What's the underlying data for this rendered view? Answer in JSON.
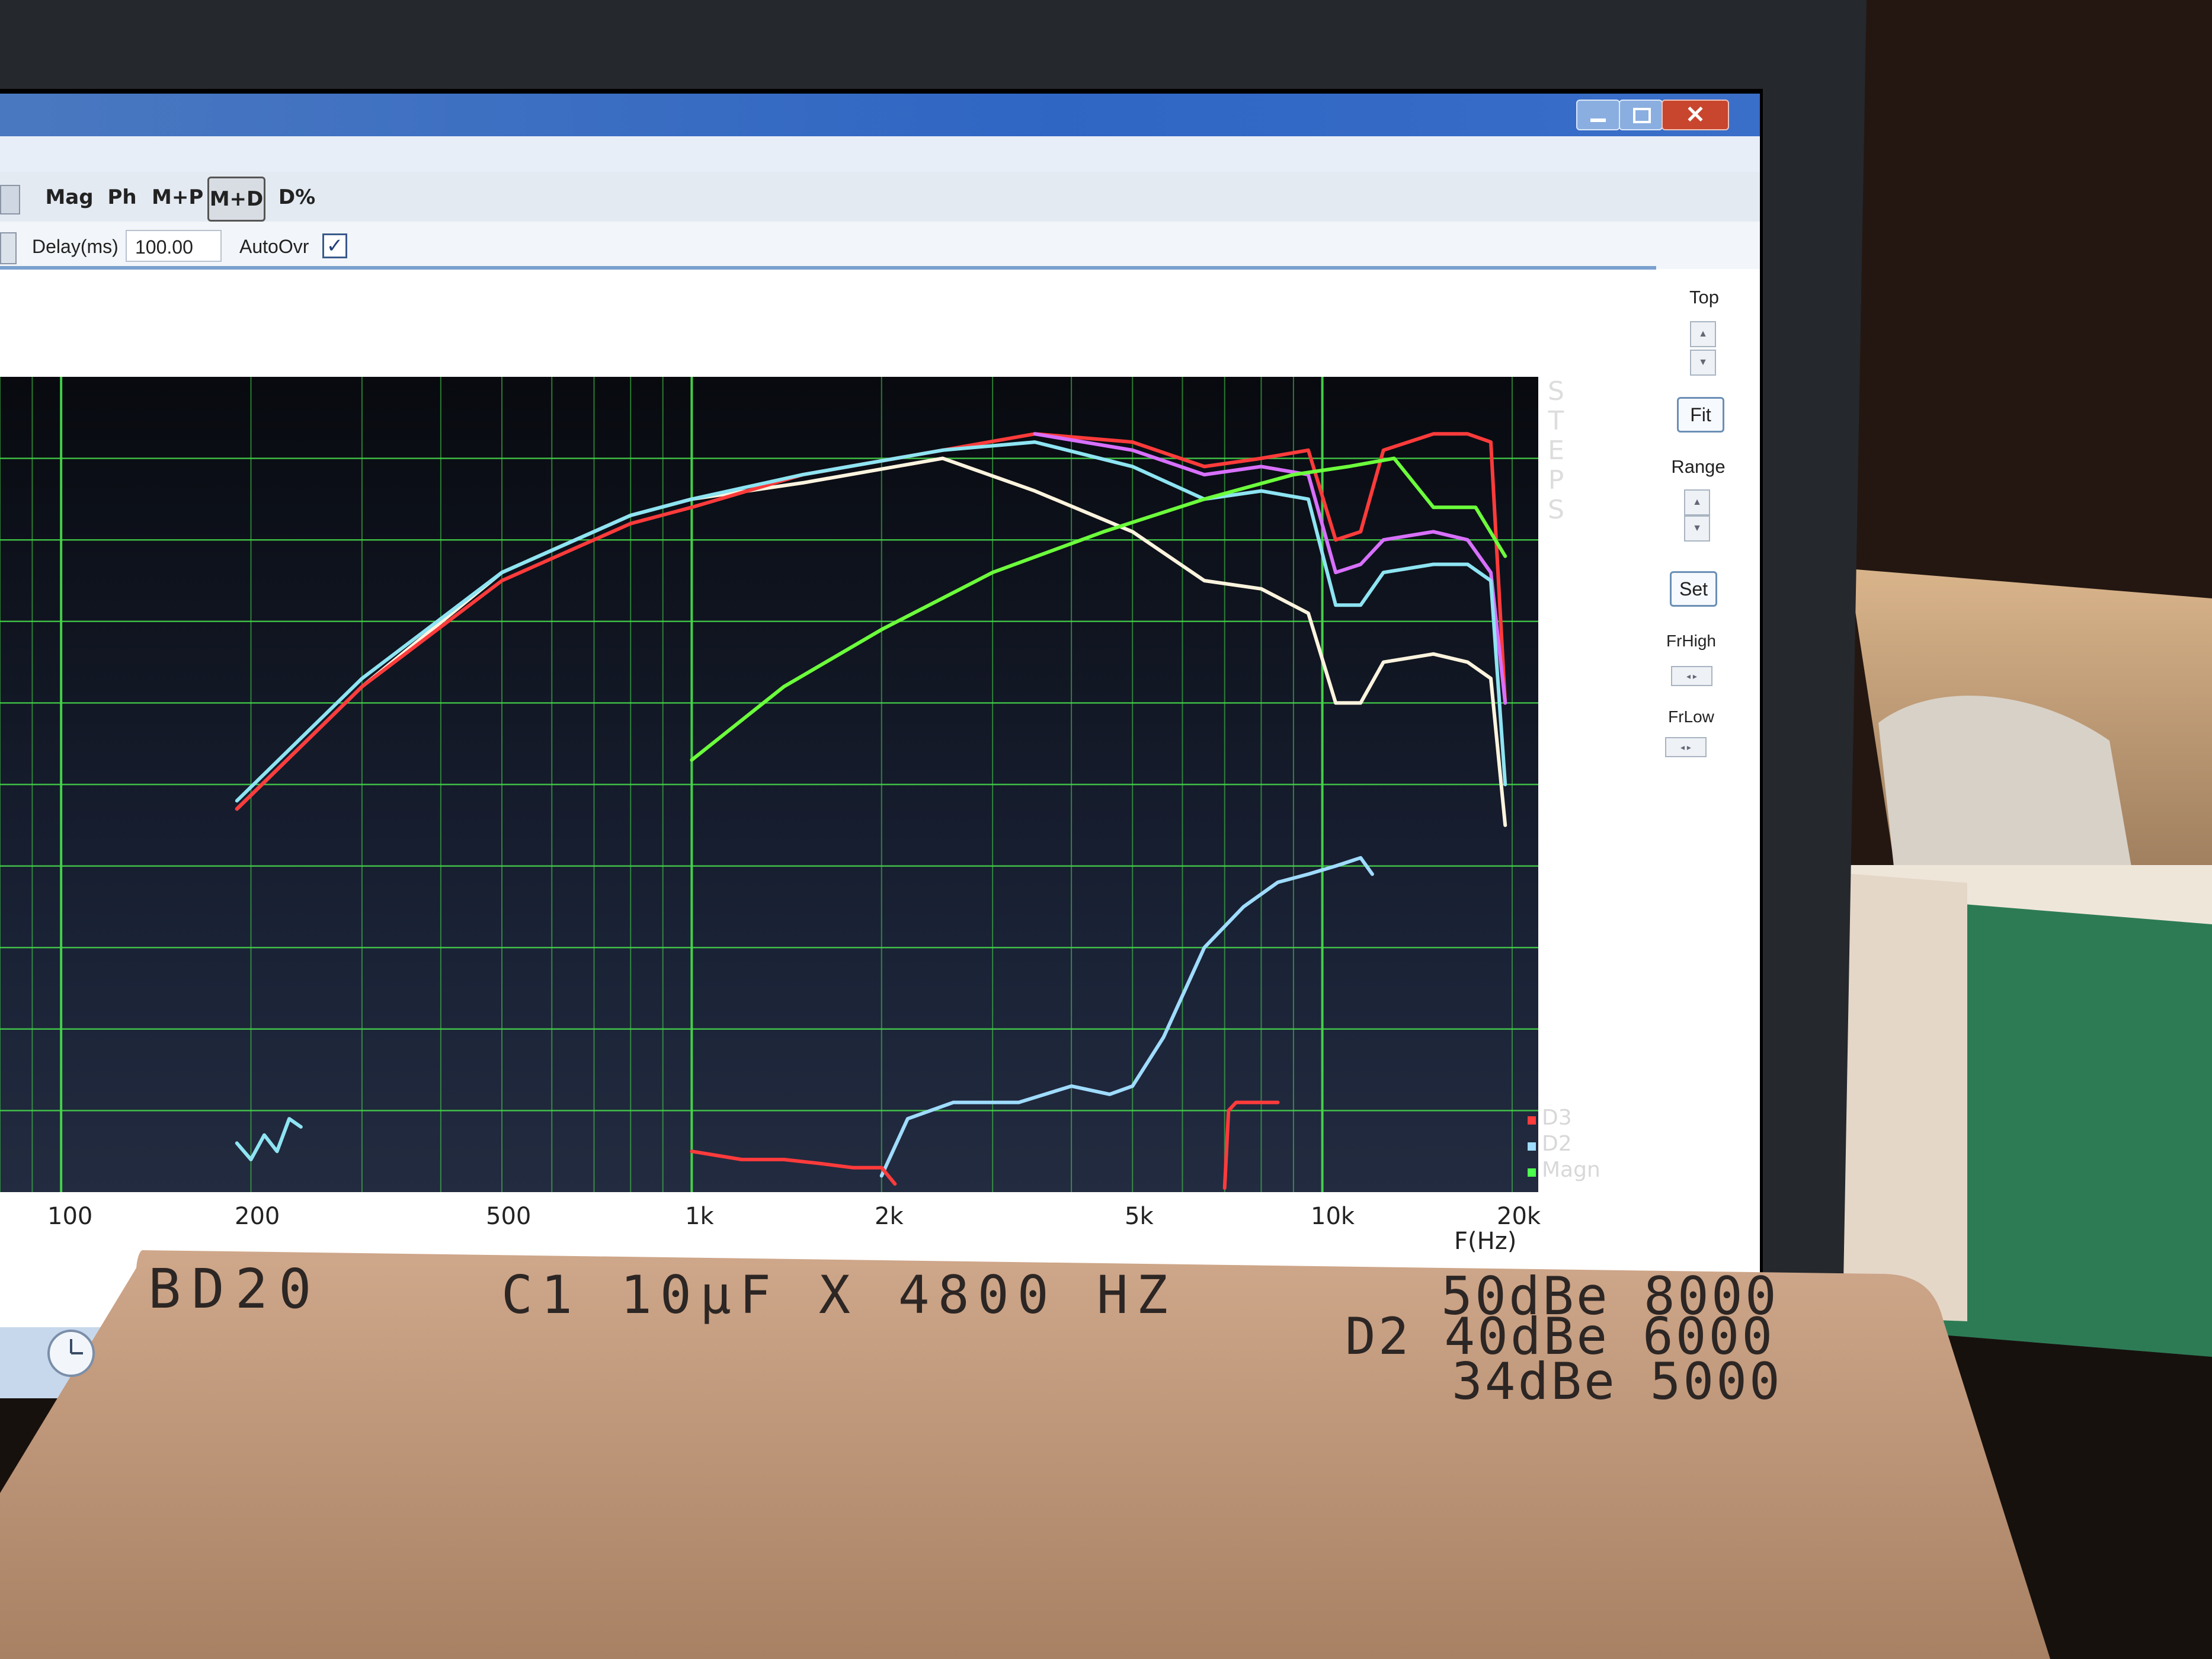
{
  "toolbar": {
    "buttons": [
      {
        "label": "Mag"
      },
      {
        "label": "Ph"
      },
      {
        "label": "M+P"
      },
      {
        "label": "M+D",
        "active": true
      },
      {
        "label": "D%"
      }
    ],
    "delay_label": "Delay(ms)",
    "delay_value": "100.00",
    "autoovr_label": "AutoOvr",
    "autoovr_checked": true
  },
  "side_panel": {
    "top_label": "Top",
    "fit_label": "Fit",
    "range_label": "Range",
    "set_label": "Set",
    "frhigh_label": "FrHigh",
    "frlow_label": "FrLow"
  },
  "window_controls": {
    "minimize": "minimize-icon",
    "restore": "restore-icon",
    "close": "close-icon"
  },
  "plot": {
    "steps_label": [
      "S",
      "T",
      "E",
      "P",
      "S"
    ],
    "x_axis_label": "F(Hz)",
    "x_ticks": [
      {
        "label": "100",
        "hz": 100
      },
      {
        "label": "200",
        "hz": 200
      },
      {
        "label": "500",
        "hz": 500
      },
      {
        "label": "1k",
        "hz": 1000
      },
      {
        "label": "2k",
        "hz": 2000
      },
      {
        "label": "5k",
        "hz": 5000
      },
      {
        "label": "10k",
        "hz": 10000
      },
      {
        "label": "20k",
        "hz": 20000
      }
    ],
    "legend": [
      {
        "label": "D3",
        "color": "#ff3b3b"
      },
      {
        "label": "D2",
        "color": "#9fdcff"
      },
      {
        "label": "Magn",
        "color": "#4cff4c"
      }
    ],
    "colors": {
      "background": "#0c1018",
      "grid": "#46d94a",
      "white_curve": "#fff4de",
      "red_curve": "#ff3b3b",
      "pink_curve": "#d870ff",
      "cyan_curve": "#8ee4f2",
      "green_curve": "#6cff3c",
      "d2_curve": "#9fdcff"
    }
  },
  "chart_data": {
    "type": "line",
    "x_scale": "log",
    "xlabel": "F(Hz)",
    "xlim": [
      80,
      22000
    ],
    "ylim": [
      0,
      10
    ],
    "grid": true,
    "legend_position": "bottom-right",
    "series": [
      {
        "color": "#fff4de",
        "x": [
          190,
          300,
          500,
          800,
          1000,
          1500,
          2500,
          3500,
          5000,
          6500,
          8000,
          9500,
          10500,
          11500,
          12500,
          15000,
          17000,
          18500,
          19500
        ],
        "y": [
          4.7,
          6.2,
          7.6,
          8.3,
          8.5,
          8.7,
          9.0,
          8.6,
          8.1,
          7.5,
          7.4,
          7.1,
          6.0,
          6.0,
          6.5,
          6.6,
          6.5,
          6.3,
          4.5
        ]
      },
      {
        "color": "#ff3b3b",
        "x": [
          190,
          300,
          500,
          800,
          1000,
          1500,
          2500,
          3500,
          5000,
          6500,
          8000,
          9500,
          10500,
          11500,
          12500,
          15000,
          17000,
          18500,
          19500
        ],
        "y": [
          4.7,
          6.2,
          7.5,
          8.2,
          8.4,
          8.8,
          9.1,
          9.3,
          9.2,
          8.9,
          9.0,
          9.1,
          8.0,
          8.1,
          9.1,
          9.3,
          9.3,
          9.2,
          6.0
        ]
      },
      {
        "color": "#d870ff",
        "x": [
          3500,
          5000,
          6500,
          8000,
          9500,
          10500,
          11500,
          12500,
          15000,
          17000,
          18500,
          19500
        ],
        "y": [
          9.3,
          9.1,
          8.8,
          8.9,
          8.8,
          7.6,
          7.7,
          8.0,
          8.1,
          8.0,
          7.6,
          6.0
        ]
      },
      {
        "color": "#8ee4f2",
        "x": [
          190,
          300,
          500,
          800,
          1000,
          1500,
          2500,
          3500,
          5000,
          6500,
          8000,
          9500,
          10500,
          11500,
          12500,
          15000,
          17000,
          18500,
          19500
        ],
        "y": [
          4.8,
          6.3,
          7.6,
          8.3,
          8.5,
          8.8,
          9.1,
          9.2,
          8.9,
          8.5,
          8.6,
          8.5,
          7.2,
          7.2,
          7.6,
          7.7,
          7.7,
          7.5,
          5.0
        ]
      },
      {
        "name": "Magn",
        "color": "#6cff3c",
        "x": [
          1000,
          1400,
          2000,
          3000,
          4500,
          6500,
          9000,
          11000,
          13000,
          15000,
          17500,
          19500
        ],
        "y": [
          5.3,
          6.2,
          6.9,
          7.6,
          8.1,
          8.5,
          8.8,
          8.9,
          9.0,
          8.4,
          8.4,
          7.8
        ]
      },
      {
        "name": "D2",
        "color": "#9fdcff",
        "x": [
          2000,
          2200,
          2600,
          3300,
          4000,
          4600,
          5000,
          5600,
          6500,
          7500,
          8500,
          9500,
          10500,
          11500,
          12000
        ],
        "y": [
          0.2,
          0.9,
          1.1,
          1.1,
          1.3,
          1.2,
          1.3,
          1.9,
          3.0,
          3.5,
          3.8,
          3.9,
          4.0,
          4.1,
          3.9
        ]
      },
      {
        "name": "D3",
        "color": "#ff3b3b",
        "x": [
          1000,
          1200,
          1400,
          1600,
          1800,
          2000,
          2100
        ],
        "y": [
          0.5,
          0.4,
          0.4,
          0.35,
          0.3,
          0.3,
          0.1
        ]
      },
      {
        "color": "#ff3b3b",
        "x": [
          7000,
          7100,
          7300,
          7800,
          8500
        ],
        "y": [
          0.05,
          1.0,
          1.1,
          1.1,
          1.1
        ]
      },
      {
        "color": "#8ee4f2",
        "x": [
          190,
          200,
          210,
          220,
          230,
          240
        ],
        "y": [
          0.6,
          0.4,
          0.7,
          0.5,
          0.9,
          0.8
        ]
      }
    ]
  },
  "handwritten_card": {
    "line1_left": "BD20",
    "line1_mid": "C1 10µF X 4800 HZ",
    "line1_right": "50dBe 8000",
    "line2": "D2 40dBe 6000",
    "line3": "34dBe 5000"
  }
}
